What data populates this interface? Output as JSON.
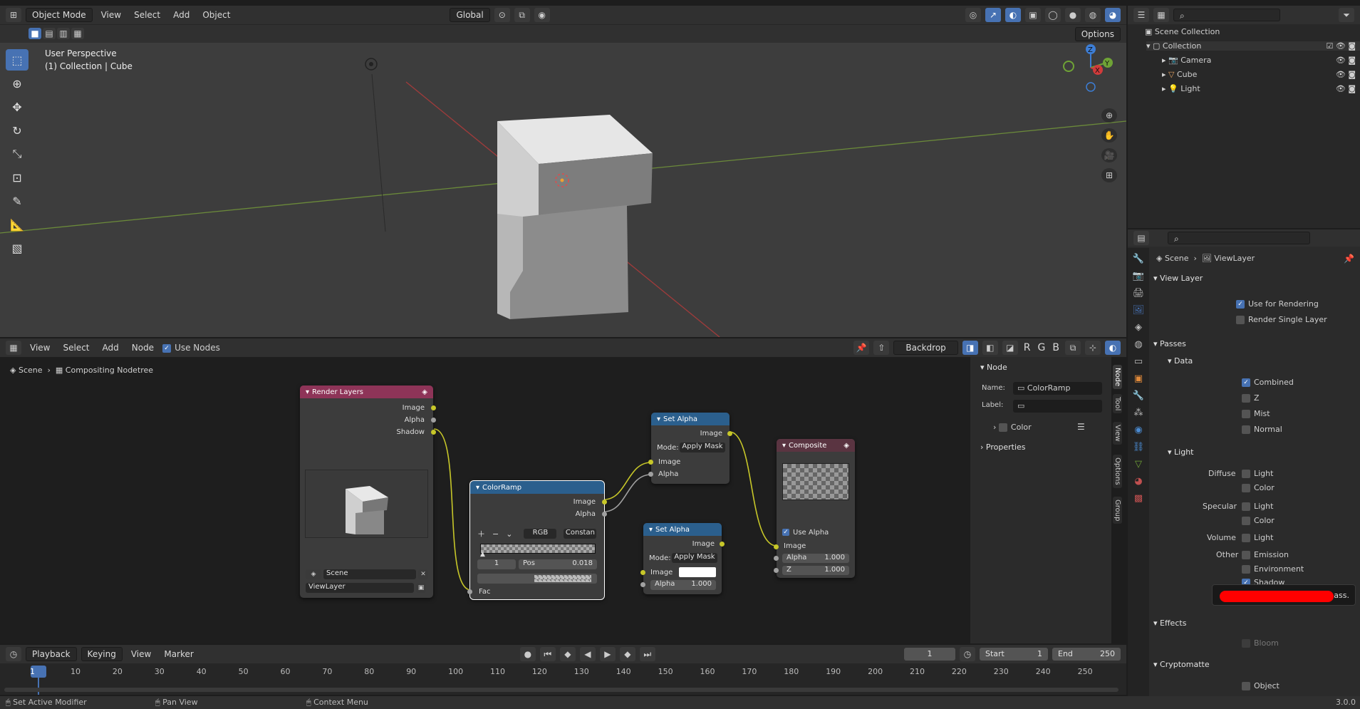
{
  "topbar": {
    "mode": "Object Mode",
    "menus": [
      "View",
      "Select",
      "Add",
      "Object"
    ],
    "orientation": "Global",
    "options": "Options"
  },
  "viewport": {
    "title": "User Perspective",
    "subtitle": "(1) Collection | Cube",
    "gizmo": {
      "x": "X",
      "y": "Y",
      "z": "Z"
    }
  },
  "outliner": {
    "scene_collection": "Scene Collection",
    "collection": "Collection",
    "items": [
      "Camera",
      "Cube",
      "Light"
    ]
  },
  "node_editor": {
    "menus": [
      "View",
      "Select",
      "Add",
      "Node"
    ],
    "use_nodes": "Use Nodes",
    "backdrop": "Backdrop",
    "channels": [
      "R",
      "G",
      "B"
    ],
    "breadcrumb": {
      "scene": "Scene",
      "tree": "Compositing Nodetree"
    },
    "render_layers": {
      "title": "Render Layers",
      "outputs": [
        "Image",
        "Alpha",
        "Shadow"
      ],
      "scene": "Scene",
      "layer": "ViewLayer"
    },
    "colorramp": {
      "title": "ColorRamp",
      "outputs": [
        "Image",
        "Alpha"
      ],
      "mode": "RGB",
      "interp": "Constan",
      "index": "1",
      "pos_label": "Pos",
      "pos_value": "0.018",
      "input": "Fac"
    },
    "set_alpha_1": {
      "title": "Set Alpha",
      "output": "Image",
      "mode_label": "Mode:",
      "mode": "Apply Mask",
      "inputs": [
        "Image",
        "Alpha"
      ]
    },
    "set_alpha_2": {
      "title": "Set Alpha",
      "output": "Image",
      "mode_label": "Mode:",
      "mode": "Apply Mask",
      "image": "Image",
      "alpha_label": "Alpha",
      "alpha_value": "1.000"
    },
    "composite": {
      "title": "Composite",
      "use_alpha": "Use Alpha",
      "image": "Image",
      "alpha_label": "Alpha",
      "alpha_value": "1.000",
      "z_label": "Z",
      "z_value": "1.000"
    },
    "sidebar": {
      "section": "Node",
      "name_label": "Name:",
      "name": "ColorRamp",
      "label_label": "Label:",
      "color": "Color",
      "properties": "Properties"
    },
    "tabs": [
      "Node",
      "Tool",
      "View",
      "Options",
      "Group"
    ]
  },
  "properties": {
    "breadcrumb": {
      "scene": "Scene",
      "layer": "ViewLayer"
    },
    "view_layer": {
      "title": "View Layer",
      "use_for_rendering": "Use for Rendering",
      "render_single": "Render Single Layer"
    },
    "passes": {
      "title": "Passes",
      "data": "Data",
      "data_items": [
        "Combined",
        "Z",
        "Mist",
        "Normal"
      ],
      "light": "Light",
      "diffuse": "Diffuse",
      "specular": "Specular",
      "volume": "Volume",
      "other": "Other",
      "light_word": "Light",
      "color_word": "Color",
      "emission": "Emission",
      "environment": "Environment",
      "shadow": "Shadow",
      "tooltip_suffix": "ass."
    },
    "effects": {
      "title": "Effects",
      "bloom": "Bloom"
    },
    "cryptomatte": {
      "title": "Cryptomatte",
      "object": "Object"
    }
  },
  "timeline": {
    "menus": [
      "Playback",
      "Keying",
      "View",
      "Marker"
    ],
    "current_frame": "1",
    "start_label": "Start",
    "start": "1",
    "end_label": "End",
    "end": "250",
    "marks": [
      "1",
      "10",
      "20",
      "30",
      "40",
      "50",
      "60",
      "70",
      "80",
      "90",
      "100",
      "110",
      "120",
      "130",
      "140",
      "150",
      "160",
      "170",
      "180",
      "190",
      "200",
      "210",
      "220",
      "230",
      "240",
      "250"
    ]
  },
  "statusbar": {
    "left": "Set Active Modifier",
    "middle": "Pan View",
    "right": "Context Menu",
    "version": "3.0.0"
  },
  "colors": {
    "accent": "#4772b3",
    "render_layers": "#8e3458",
    "colorramp": "#2b5f8d",
    "composite": "#5a3441",
    "socket_color": "#c7c729"
  }
}
